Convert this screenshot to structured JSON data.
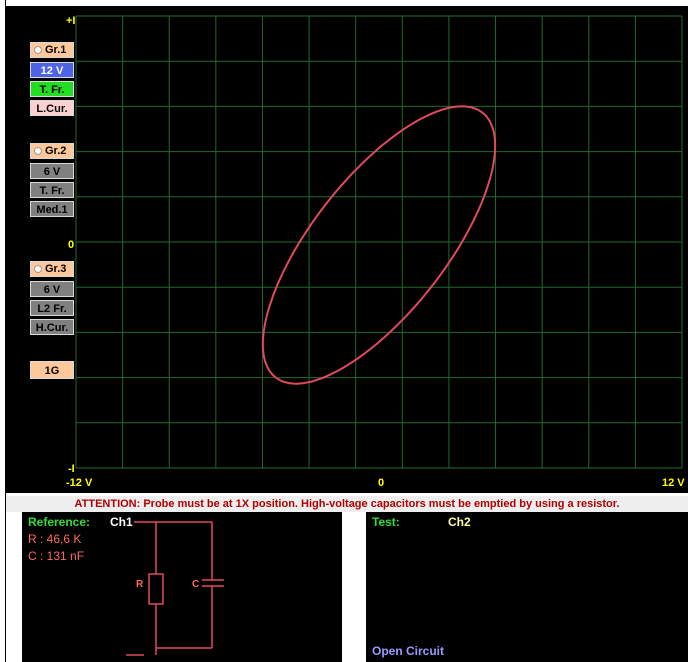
{
  "colors": {
    "plot_bg": "#000000",
    "grid": "#1e6b2e",
    "trace": "#e04a5a",
    "axis_label": "#ffff00",
    "warning_text": "#b00000",
    "reference_label": "#33dd33",
    "test_label": "#33dd33",
    "ref_values": "#ff6a5a",
    "open_circuit": "#9a9aff"
  },
  "groups": [
    {
      "radio_label": "Gr.1",
      "buttons": [
        {
          "label": "12 V",
          "bg": "#4d63e8",
          "fg": "#ffffff"
        },
        {
          "label": "T. Fr.",
          "bg": "#22dd22",
          "fg": "#000000"
        },
        {
          "label": "L.Cur.",
          "bg": "#ffd0d0",
          "fg": "#000000"
        }
      ]
    },
    {
      "radio_label": "Gr.2",
      "buttons": [
        {
          "label": "6 V",
          "bg": "#808080",
          "fg": "#000000"
        },
        {
          "label": "T. Fr.",
          "bg": "#808080",
          "fg": "#000000"
        },
        {
          "label": "Med.1",
          "bg": "#808080",
          "fg": "#000000"
        }
      ]
    },
    {
      "radio_label": "Gr.3",
      "buttons": [
        {
          "label": "6 V",
          "bg": "#808080",
          "fg": "#000000"
        },
        {
          "label": "L2 Fr.",
          "bg": "#808080",
          "fg": "#000000"
        },
        {
          "label": "H.Cur.",
          "bg": "#808080",
          "fg": "#000000"
        }
      ]
    }
  ],
  "speed_button": "1G",
  "axis": {
    "y_top": "+I",
    "y_mid": "0",
    "y_bottom": "-I",
    "x_left": "-12 V",
    "x_mid": "0",
    "x_right": "12 V"
  },
  "warning": "ATTENTION: Probe must be at 1X position. High-voltage capacitors must be emptied by using a resistor.",
  "reference": {
    "title": "Reference:",
    "channel": "Ch1",
    "r_value": "R : 46,6 K",
    "c_value": "C : 131 nF",
    "r_symbol": "R",
    "c_symbol": "C"
  },
  "test": {
    "title": "Test:",
    "channel": "Ch2",
    "status": "Open Circuit"
  }
}
